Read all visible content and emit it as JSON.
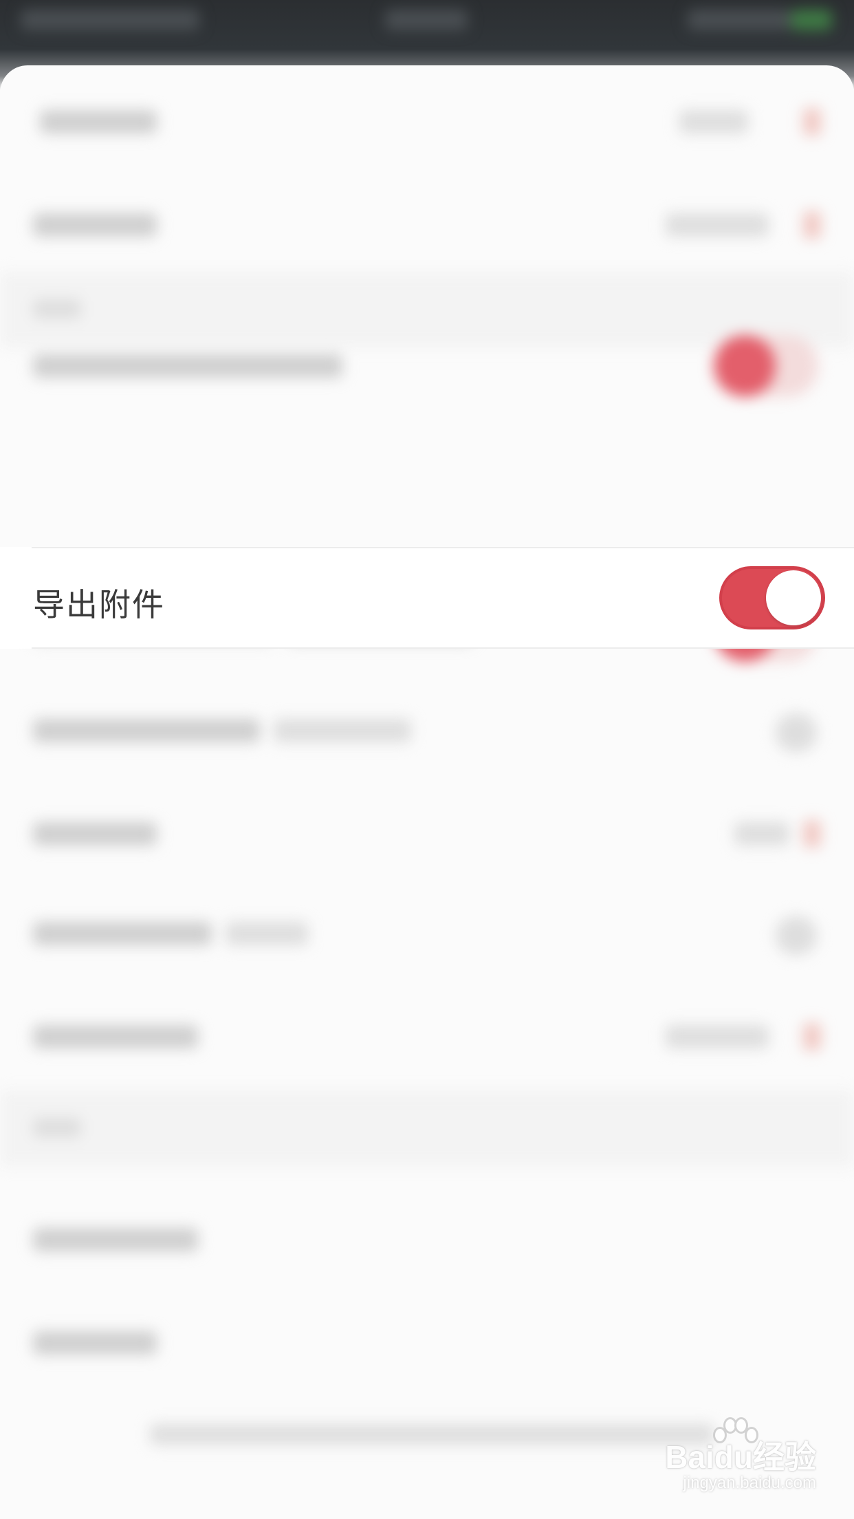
{
  "settings": {
    "export_attachments": {
      "label": "导出附件",
      "enabled": true
    }
  },
  "colors": {
    "accent": "#dc4a55",
    "statusbar": "#2b2e31",
    "background": "#fbfbfb"
  },
  "watermark": {
    "logo": "Baidu经验",
    "url": "jingyan.baidu.com"
  }
}
